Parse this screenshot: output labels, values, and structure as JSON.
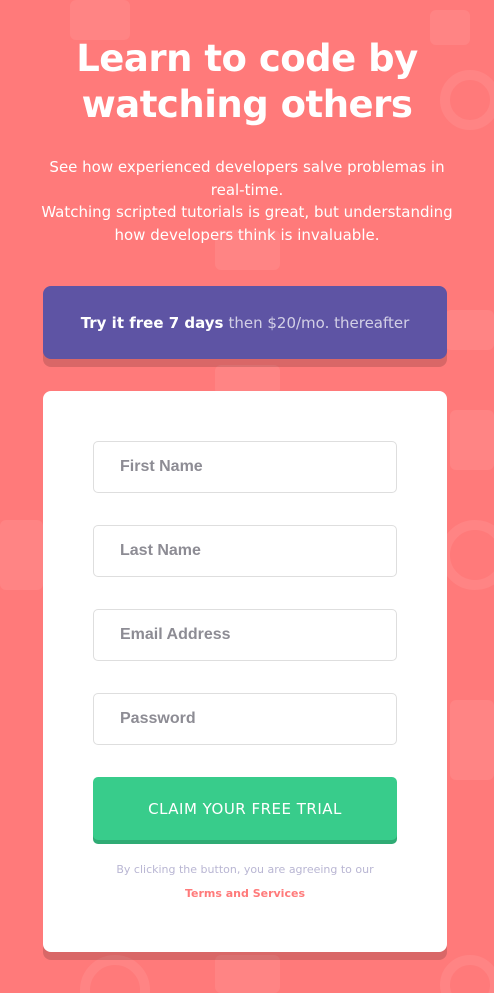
{
  "hero": {
    "title": "Learn to code by watching others",
    "description_line1": "See how experienced developers salve problemas in real-time.",
    "description_line2": "Watching scripted tutorials is great, but understanding how developers think is invaluable."
  },
  "trial_banner": {
    "strong": "Try it free 7 days",
    "light": "then $20/mo. thereafter"
  },
  "form": {
    "first_name_placeholder": "First Name",
    "last_name_placeholder": "Last Name",
    "email_placeholder": "Email Address",
    "password_placeholder": "Password",
    "submit_label": "CLAIM YOUR FREE TRIAL",
    "terms_text": "By clicking the button, you are agreeing to our",
    "terms_link": "Terms and Services"
  },
  "colors": {
    "background": "#ff7a7a",
    "banner": "#5e54a4",
    "button": "#38cc8b",
    "link": "#ff7a7a"
  }
}
